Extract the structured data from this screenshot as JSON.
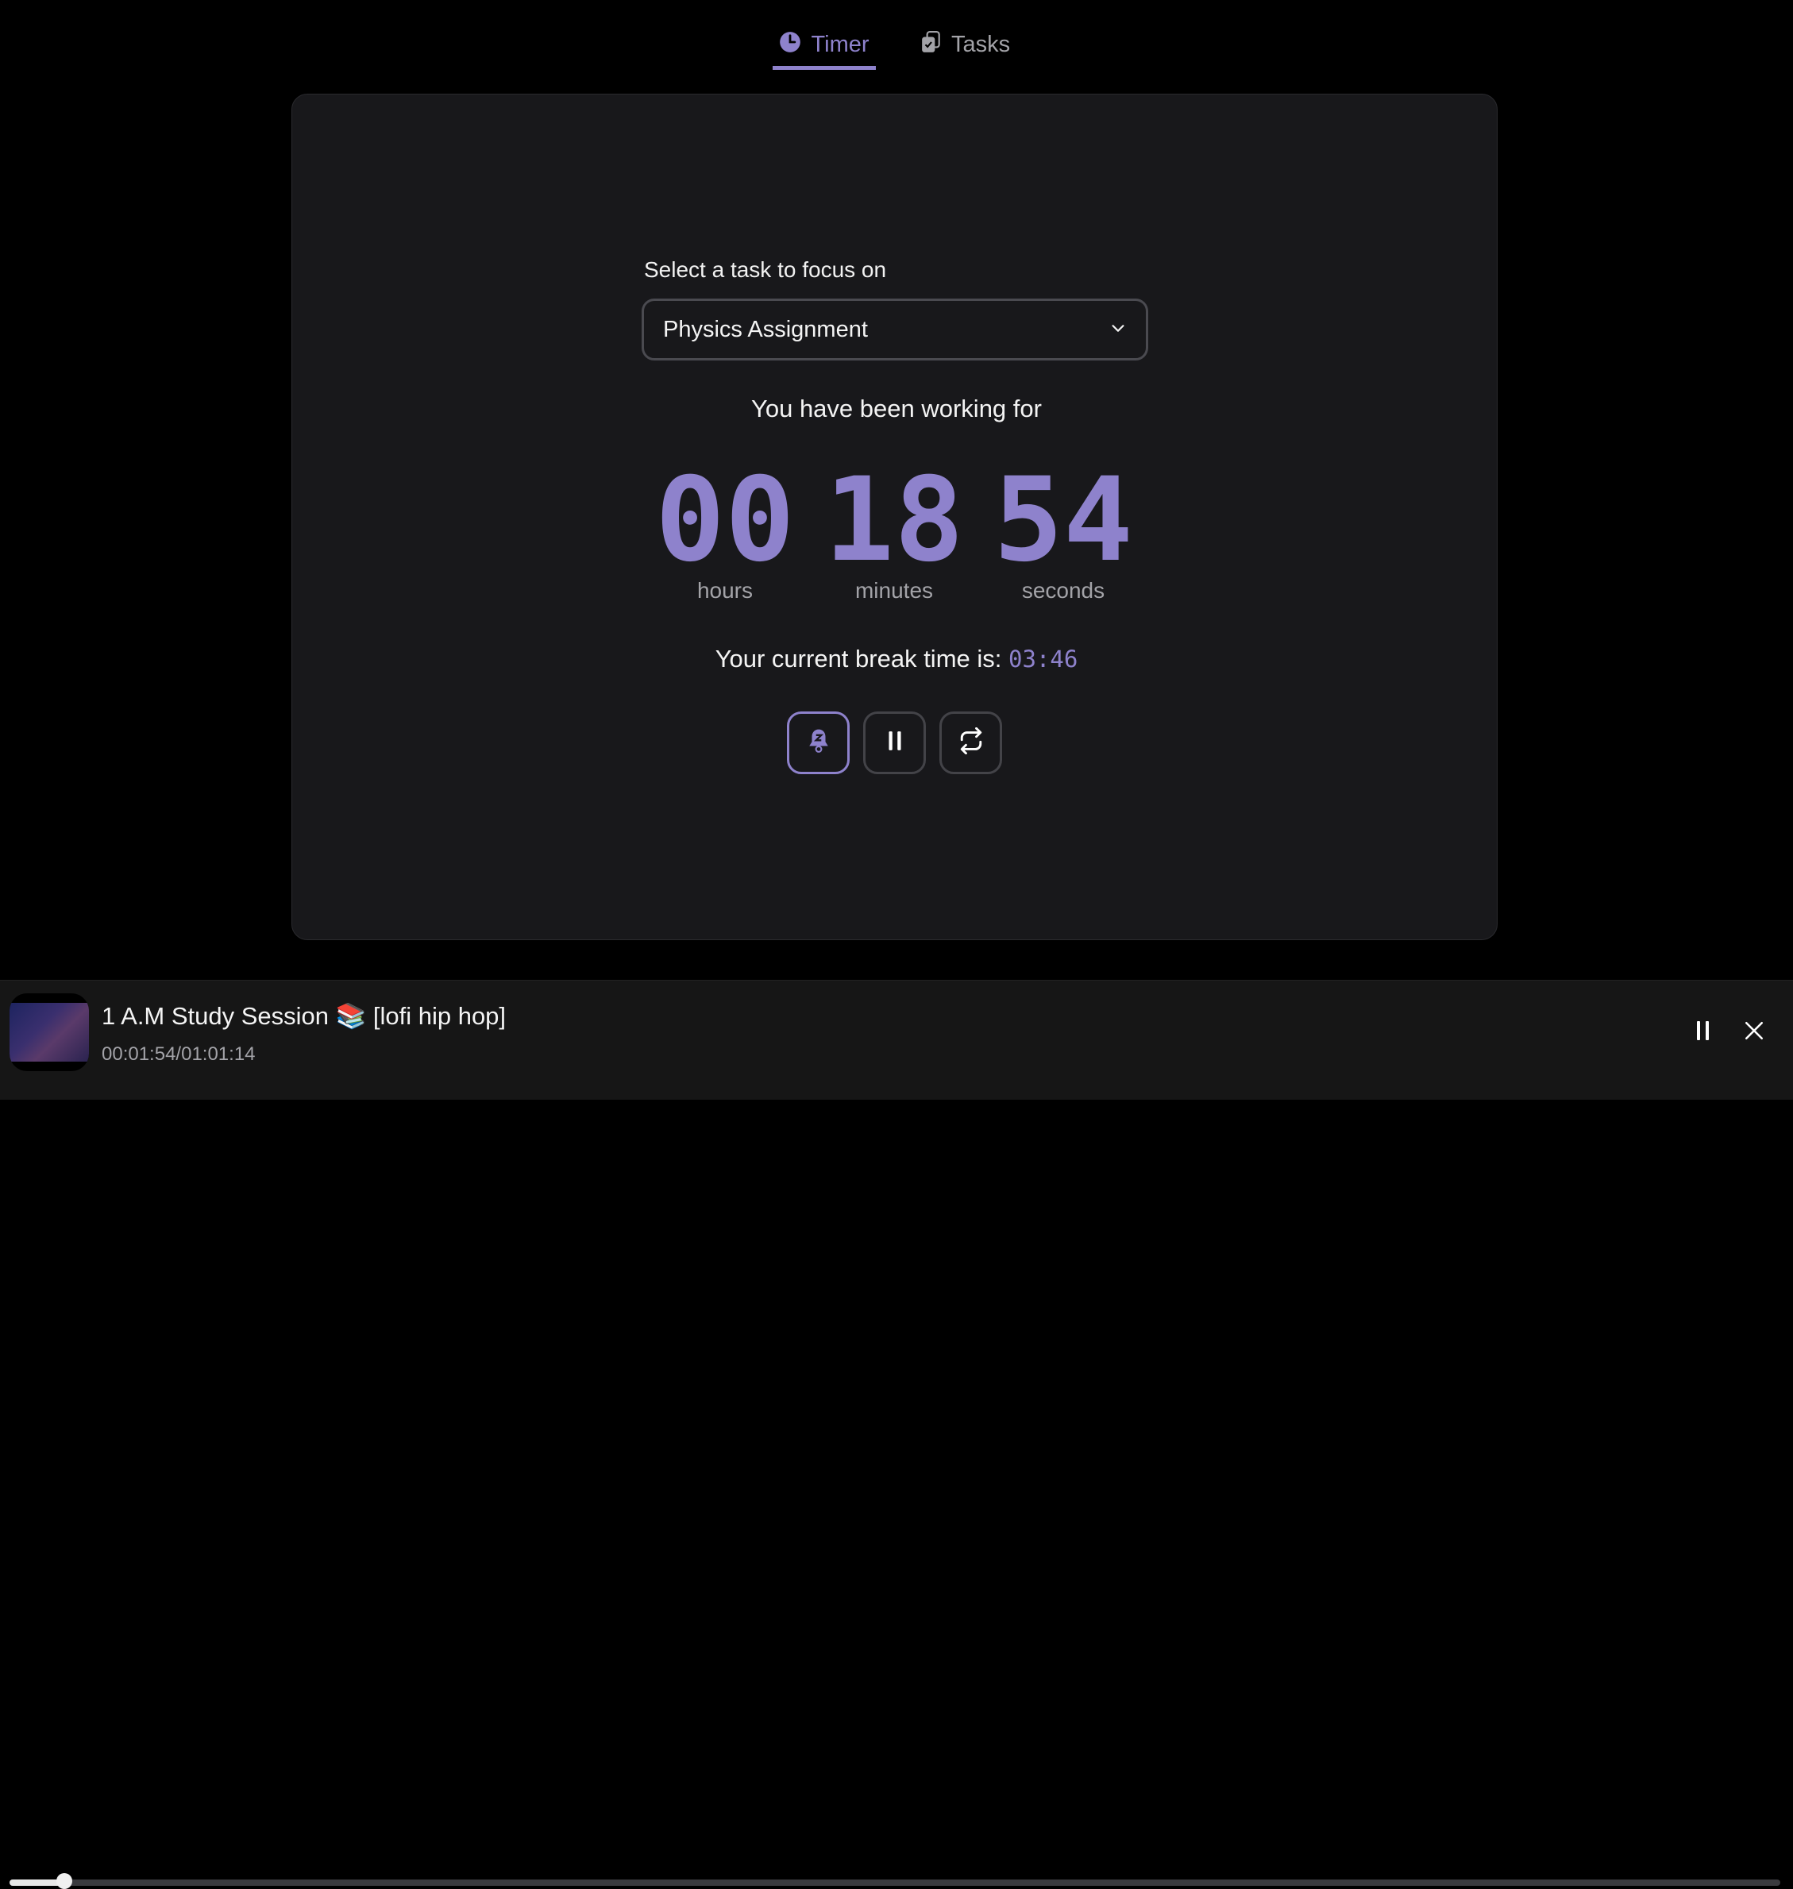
{
  "tabs": [
    {
      "label": "Timer",
      "icon": "clock-icon",
      "active": true
    },
    {
      "label": "Tasks",
      "icon": "clipboard-check-icon",
      "active": false
    }
  ],
  "timer": {
    "select_label": "Select a task to focus on",
    "selected_task": "Physics Assignment",
    "working_text": "You have been working for",
    "hours": "00",
    "minutes": "18",
    "seconds": "54",
    "hours_label": "hours",
    "minutes_label": "minutes",
    "seconds_label": "seconds",
    "break_text": "Your current break time is:",
    "break_value": "03:46",
    "accent": "#8e82cc"
  },
  "player": {
    "title": "1 A.M Study Session 📚 [lofi hip hop]",
    "time": "00:01:54/01:01:14",
    "progress_percent": 3.1
  }
}
